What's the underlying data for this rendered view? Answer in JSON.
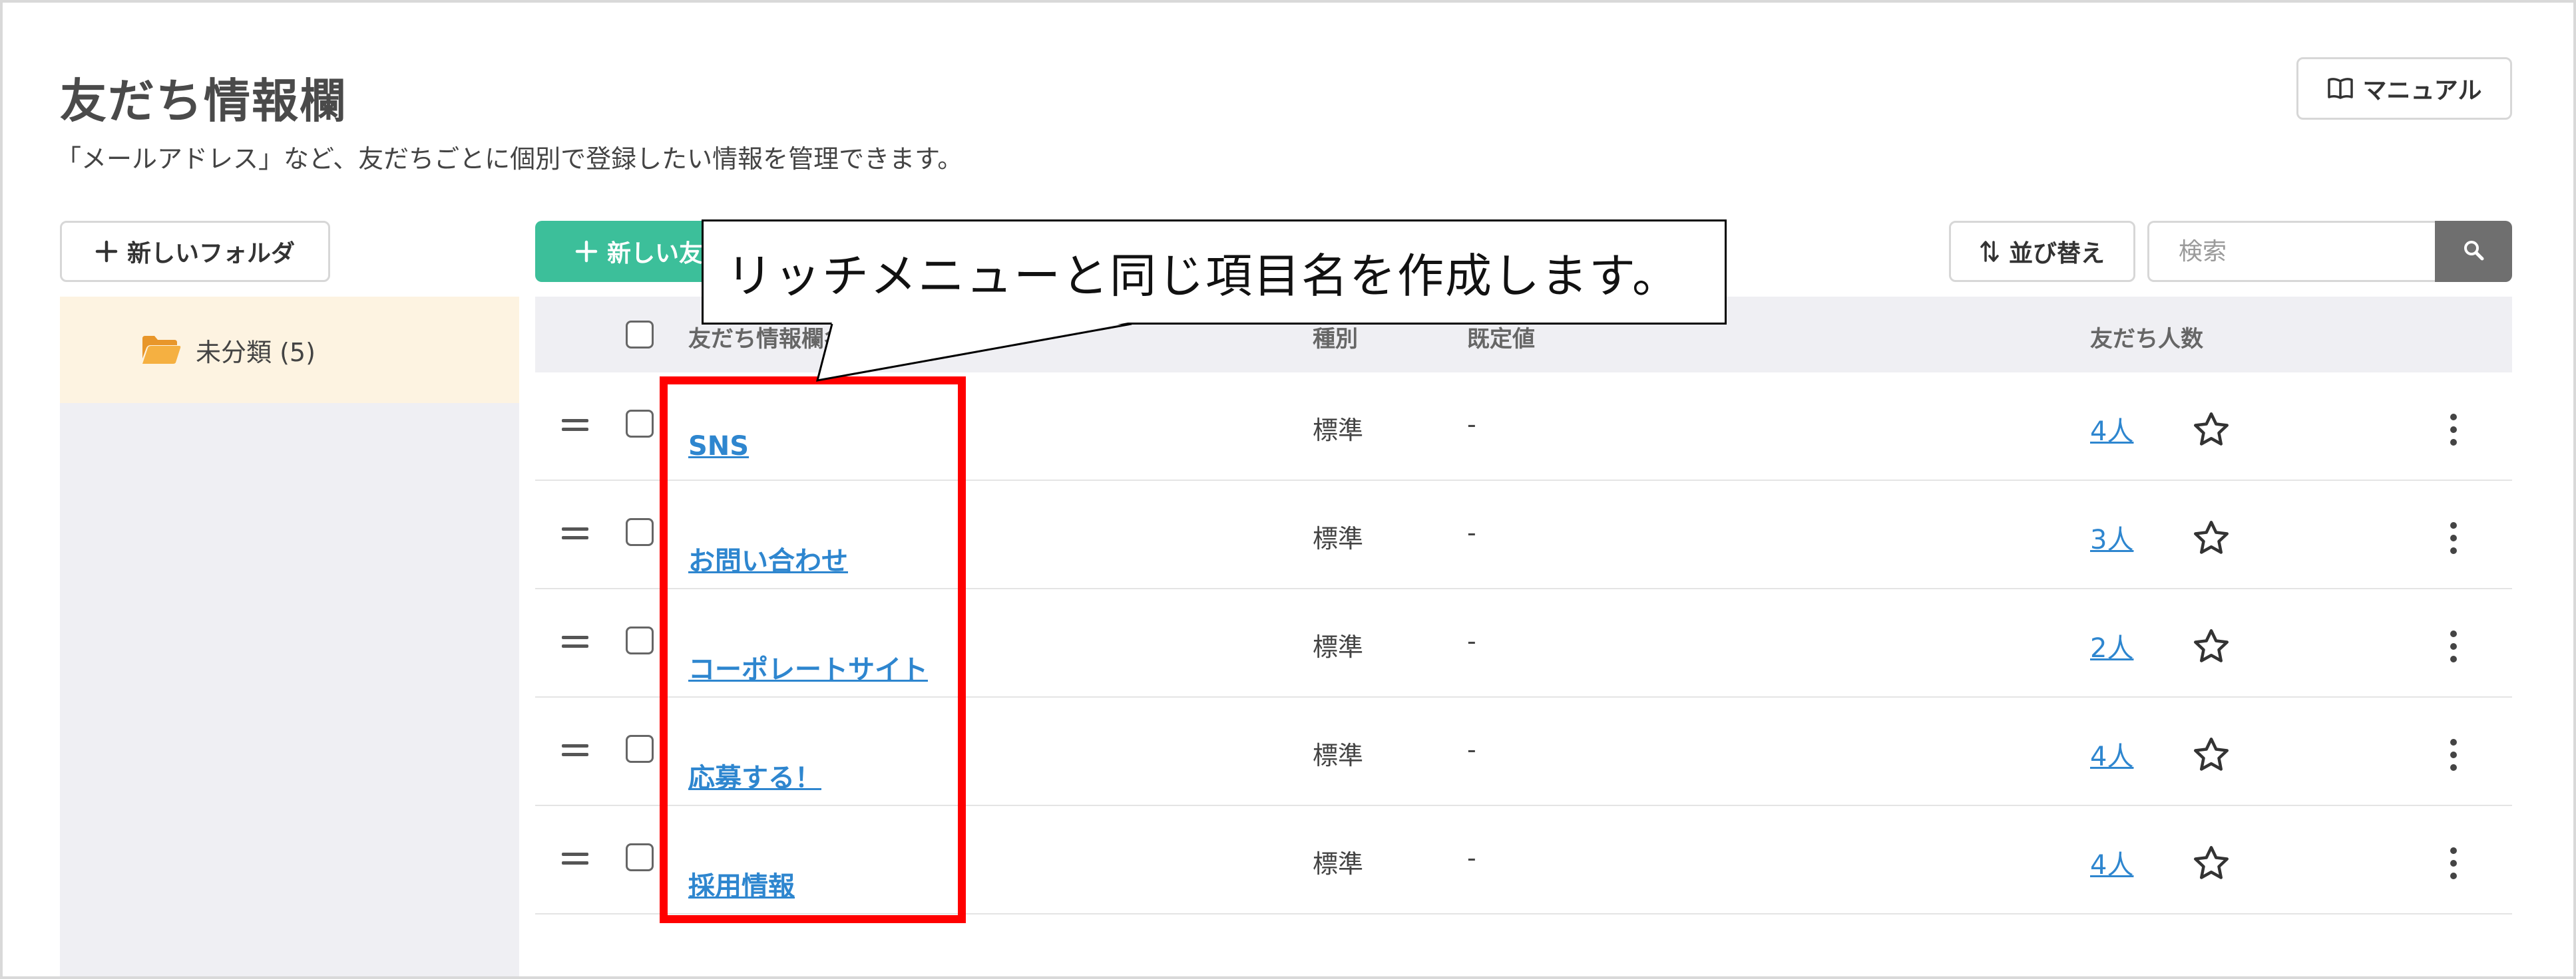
{
  "header": {
    "title": "友だち情報欄",
    "description": "「メールアドレス」など、友だちごとに個別で登録したい情報を管理できます。",
    "manual_label": "マニュアル"
  },
  "toolbar": {
    "new_folder_label": "新しいフォルダ",
    "new_item_label": "新しい友",
    "sort_label": "並び替え",
    "search_placeholder": "検索"
  },
  "sidebar": {
    "folders": [
      {
        "label": "未分類 (5)",
        "selected": true
      }
    ]
  },
  "table": {
    "columns": {
      "name": "友だち情報欄名",
      "type": "種別",
      "default": "既定値",
      "count": "友だち人数"
    },
    "rows": [
      {
        "name": "SNS",
        "type": "標準",
        "default": "-",
        "count": "4人"
      },
      {
        "name": "お問い合わせ",
        "type": "標準",
        "default": "-",
        "count": "3人"
      },
      {
        "name": "コーポレートサイト",
        "type": "標準",
        "default": "-",
        "count": "2人"
      },
      {
        "name": "応募する！",
        "type": "標準",
        "default": "-",
        "count": "4人"
      },
      {
        "name": "採用情報",
        "type": "標準",
        "default": "-",
        "count": "4人"
      }
    ]
  },
  "annotation": {
    "callout_text": "リッチメニューと同じ項目名を作成します。"
  },
  "colors": {
    "accent_green": "#3cbf9a",
    "link_blue": "#2e86cf",
    "highlight_red": "#ff0000",
    "folder_orange": "#f0a430"
  },
  "icons": {
    "manual": "book-icon",
    "new_folder": "plus-icon",
    "new_item": "plus-icon",
    "sort": "sort-arrows-icon",
    "search": "search-icon",
    "folder": "folder-open-icon",
    "row_favorite": "star-outline-icon",
    "row_menu": "kebab-menu-icon",
    "row_drag": "drag-handle-icon"
  }
}
